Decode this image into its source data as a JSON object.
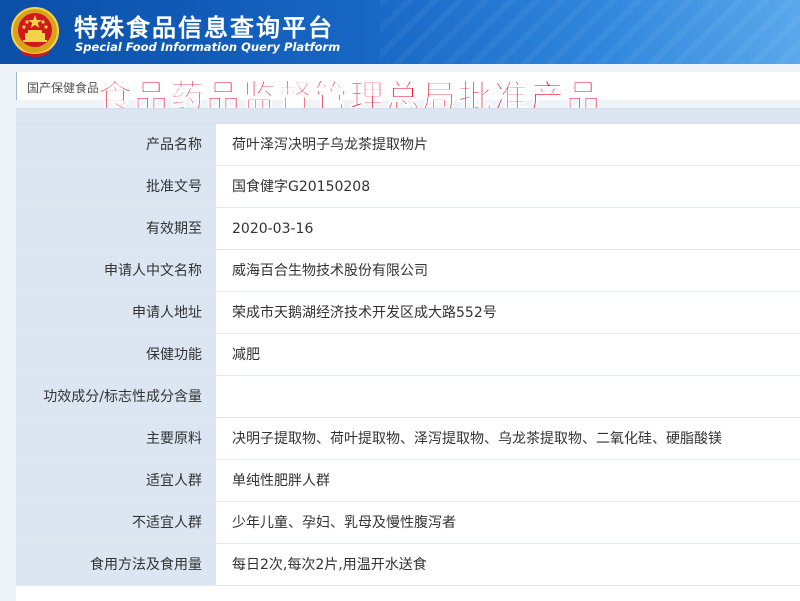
{
  "header": {
    "title": "特殊食品信息查询平台",
    "subtitle": "Special Food Information Query Platform"
  },
  "breadcrumb": "国产保健食品",
  "banner": "食品药品监督管理总局批准产品",
  "fields": [
    {
      "label": "产品名称",
      "value": "荷叶泽泻决明子乌龙茶提取物片"
    },
    {
      "label": "批准文号",
      "value": "国食健字G20150208"
    },
    {
      "label": "有效期至",
      "value": "2020-03-16"
    },
    {
      "label": "申请人中文名称",
      "value": "威海百合生物技术股份有限公司"
    },
    {
      "label": "申请人地址",
      "value": "荣成市天鹅湖经济技术开发区成大路552号"
    },
    {
      "label": "保健功能",
      "value": "减肥"
    },
    {
      "label": "功效成分/标志性成分含量",
      "value": ""
    },
    {
      "label": "主要原料",
      "value": "决明子提取物、荷叶提取物、泽泻提取物、乌龙茶提取物、二氧化硅、硬脂酸镁"
    },
    {
      "label": "适宜人群",
      "value": "单纯性肥胖人群"
    },
    {
      "label": "不适宜人群",
      "value": "少年儿童、孕妇、乳母及慢性腹泻者"
    },
    {
      "label": "食用方法及食用量",
      "value": "每日2次,每次2片,用温开水送食"
    }
  ],
  "colors": {
    "header_blue": "#0a4fa8",
    "banner_red": "#e6001e",
    "label_bg": "#dbe6f2"
  },
  "icons": {
    "emblem": "national-emblem-icon"
  }
}
